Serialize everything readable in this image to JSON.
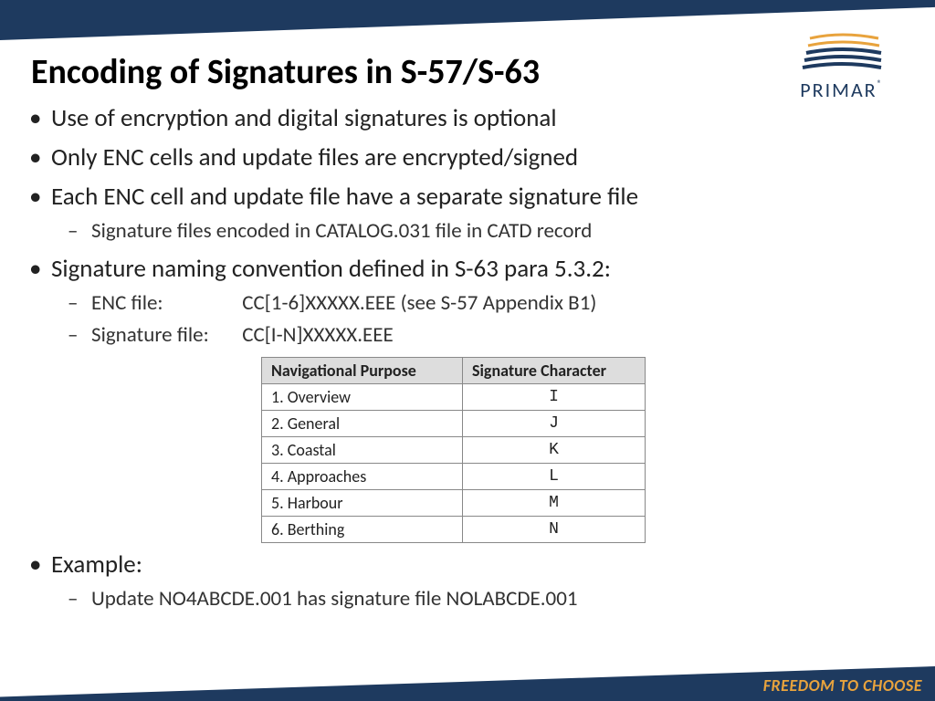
{
  "title": "Encoding of Signatures in S-57/S-63",
  "brand": {
    "name": "PRIMAR",
    "tagline": "FREEDOM TO CHOOSE"
  },
  "bullets": {
    "b1": "Use of encryption and digital signatures is optional",
    "b2": "Only ENC cells and update files are encrypted/signed",
    "b3": "Each ENC cell and update file have a separate signature file",
    "b3s1": "Signature files encoded in CATALOG.031 file in CATD record",
    "b4": "Signature naming convention defined in S-63 para 5.3.2:",
    "b4s1_label": "ENC file:",
    "b4s1_value": "CC[1-6]XXXXX.EEE (see S-57 Appendix B1)",
    "b4s2_label": "Signature file:",
    "b4s2_value": "CC[I-N]XXXXX.EEE",
    "b5": "Example:",
    "b5s1": "Update NO4ABCDE.001 has signature file NOLABCDE.001"
  },
  "table": {
    "h1": "Navigational Purpose",
    "h2": "Signature Character",
    "rows": [
      {
        "nav": "1. Overview",
        "sig": "I"
      },
      {
        "nav": "2. General",
        "sig": "J"
      },
      {
        "nav": "3. Coastal",
        "sig": "K"
      },
      {
        "nav": "4. Approaches",
        "sig": "L"
      },
      {
        "nav": "5. Harbour",
        "sig": "M"
      },
      {
        "nav": "6. Berthing",
        "sig": "N"
      }
    ]
  }
}
